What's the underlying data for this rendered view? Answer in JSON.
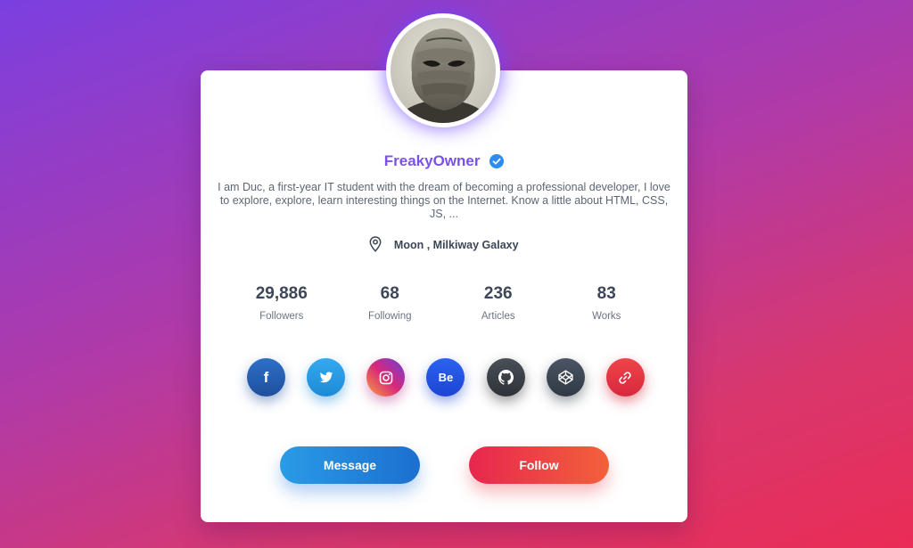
{
  "profile": {
    "name": "FreakyOwner",
    "bio": "I am Duc, a first-year IT student with the dream of becoming a professional developer, I love to explore, explore, learn interesting things on the Internet. Know a little about HTML, CSS, JS, ...",
    "location": "Moon , Milkiway Galaxy",
    "verified": true
  },
  "stats": [
    {
      "value": "29,886",
      "label": "Followers"
    },
    {
      "value": "68",
      "label": "Following"
    },
    {
      "value": "236",
      "label": "Articles"
    },
    {
      "value": "83",
      "label": "Works"
    }
  ],
  "socials": [
    {
      "icon": "facebook-icon",
      "glyph": "f",
      "color": "#2d6fc7"
    },
    {
      "icon": "twitter-icon",
      "glyph": "",
      "color": "#35a9ef"
    },
    {
      "icon": "instagram-icon",
      "glyph": "",
      "color": "#c13584"
    },
    {
      "icon": "behance-icon",
      "glyph": "Be",
      "color": "#2a63f0"
    },
    {
      "icon": "github-icon",
      "glyph": "",
      "color": "#3a3f46"
    },
    {
      "icon": "codepen-icon",
      "glyph": "",
      "color": "#3c4552"
    },
    {
      "icon": "link-icon",
      "glyph": "",
      "color": "#e63946"
    }
  ],
  "buttons": {
    "message": "Message",
    "follow": "Follow"
  },
  "colors": {
    "name": "#7b52e8",
    "verified": "#2d8cf0",
    "message_btn": "#2a9be6",
    "follow_btn": "#e8264f"
  }
}
